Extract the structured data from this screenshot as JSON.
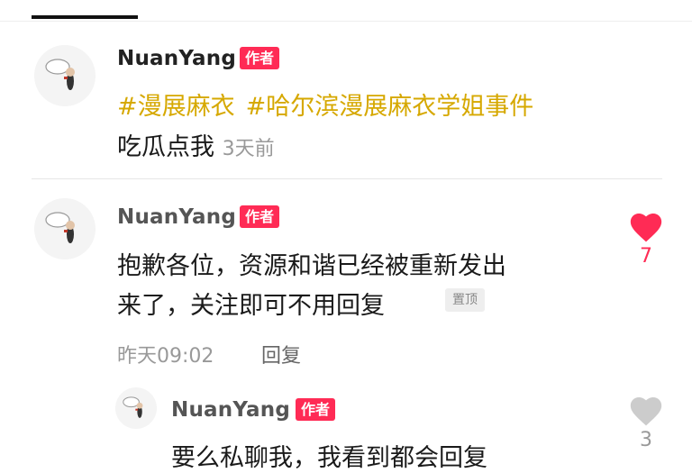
{
  "comments": [
    {
      "username": "NuanYang",
      "badge": "作者",
      "hashtags": [
        "#漫展麻衣",
        "#哈尔滨漫展麻衣学姐事件"
      ],
      "body": "吃瓜点我",
      "time": "3天前"
    },
    {
      "username": "NuanYang",
      "badge": "作者",
      "body_line1": "抱歉各位，资源和谐已经被重新发出",
      "body_line2": "来了，关注即可不用回复",
      "pin_label": "置顶",
      "time": "昨天09:02",
      "reply_label": "回复",
      "like_count": "7",
      "liked": true
    },
    {
      "username": "NuanYang",
      "badge": "作者",
      "body": "要么私聊我，我看到都会回复",
      "like_count": "3",
      "liked": false
    }
  ],
  "colors": {
    "accent": "#ff2b55",
    "hashtag": "#d6a800",
    "muted": "#999999",
    "like_inactive": "#cccccc"
  },
  "icons": [
    "avatar-image",
    "heart-icon"
  ]
}
